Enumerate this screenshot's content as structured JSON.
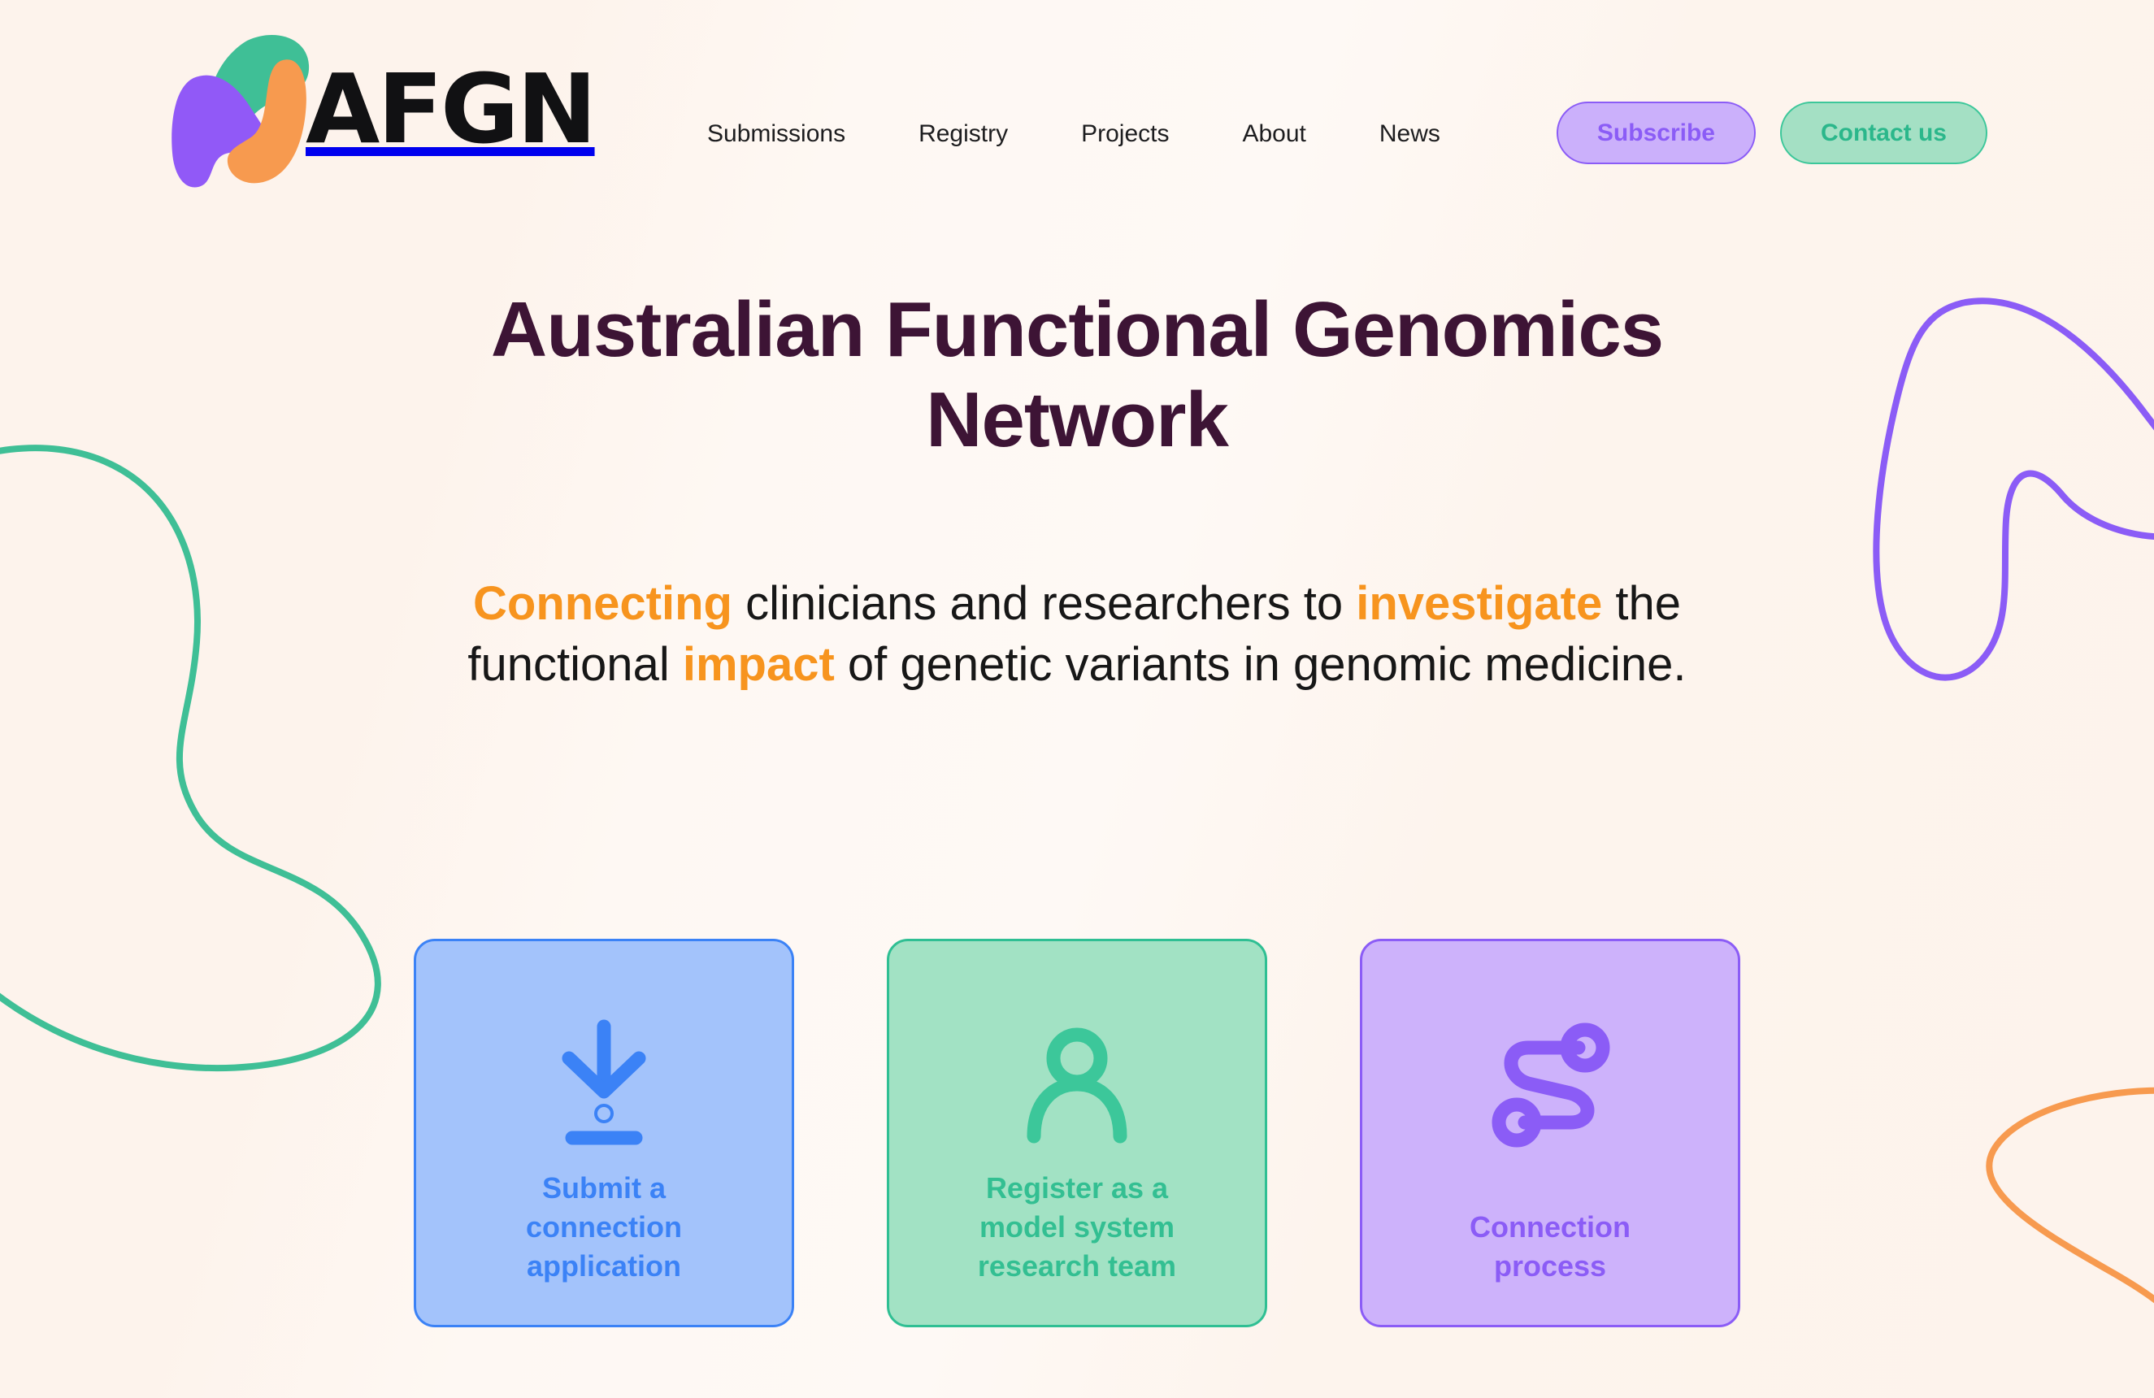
{
  "site": {
    "background_color": "#fdf4ed",
    "logo": {
      "wordmark": "AFGN",
      "icon_name": "afgn-blob-logo",
      "colors": {
        "green": "#3fbf96",
        "orange": "#f79a4f",
        "purple": "#9159f7"
      }
    }
  },
  "nav": {
    "items": [
      {
        "label": "Submissions"
      },
      {
        "label": "Registry"
      },
      {
        "label": "Projects"
      },
      {
        "label": "About"
      },
      {
        "label": "News"
      }
    ]
  },
  "header_actions": {
    "subscribe": {
      "label": "Subscribe",
      "bg": "#cbb0fb",
      "fg": "#8b5cf6"
    },
    "contact": {
      "label": "Contact us",
      "bg": "#a4e0c4",
      "fg": "#2bb78b"
    }
  },
  "hero": {
    "title": "Australian Functional Genomics Network",
    "title_color": "#3d1435",
    "subtitle": {
      "highlight_color": "#f7941e",
      "parts": [
        {
          "text": "Connecting",
          "emphasis": true
        },
        {
          "text": " clinicians and researchers to ",
          "emphasis": false
        },
        {
          "text": "investigate",
          "emphasis": true
        },
        {
          "text": " the functional ",
          "emphasis": false
        },
        {
          "text": "impact",
          "emphasis": true
        },
        {
          "text": " of genetic variants in genomic medicine.",
          "emphasis": false
        }
      ],
      "plain_text": "Connecting clinicians and researchers to investigate the functional impact of genetic variants in genomic medicine."
    }
  },
  "cards": [
    {
      "label": "Submit a connection application",
      "icon_name": "download-submit-icon",
      "bg": "#a3c3fb",
      "border": "#3b82f6",
      "fg": "#3b82f6"
    },
    {
      "label": "Register as a model system research team",
      "icon_name": "person-icon",
      "bg": "#a2e2c4",
      "border": "#2fbf93",
      "fg": "#33bf92"
    },
    {
      "label": "Connection process",
      "icon_name": "connection-path-icon",
      "bg": "#cdb2fb",
      "border": "#8b5cf6",
      "fg": "#8b5cf6"
    }
  ],
  "decorations": [
    {
      "name": "green-blob-outline",
      "color": "#3fbf96"
    },
    {
      "name": "purple-blob-outline",
      "color": "#8b5cf6"
    },
    {
      "name": "orange-curve-outline",
      "color": "#f79a4f"
    }
  ]
}
